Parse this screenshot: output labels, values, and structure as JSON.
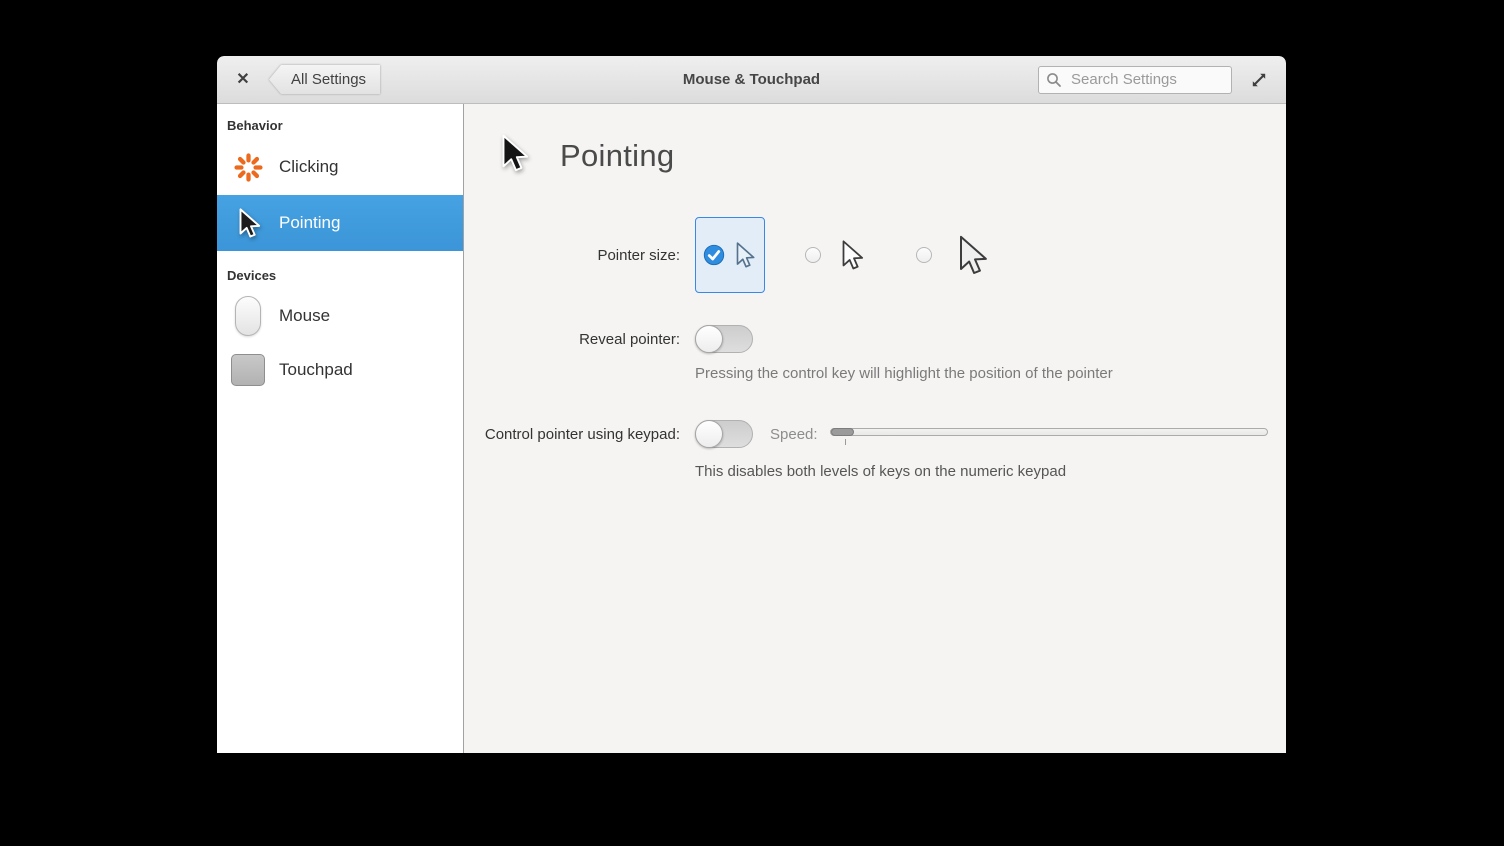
{
  "header": {
    "close_glyph": "✕",
    "back_label": "All Settings",
    "title": "Mouse & Touchpad",
    "search_placeholder": "Search Settings"
  },
  "sidebar": {
    "sections": [
      {
        "label": "Behavior",
        "items": [
          {
            "label": "Clicking",
            "icon": "clicking-burst-icon",
            "selected": false
          },
          {
            "label": "Pointing",
            "icon": "pointer-cursor-icon",
            "selected": true
          }
        ]
      },
      {
        "label": "Devices",
        "items": [
          {
            "label": "Mouse",
            "icon": "mouse-icon",
            "selected": false
          },
          {
            "label": "Touchpad",
            "icon": "touchpad-icon",
            "selected": false
          }
        ]
      }
    ]
  },
  "content": {
    "title": "Pointing",
    "pointer_size": {
      "label": "Pointer size:",
      "options": [
        "small",
        "medium",
        "large"
      ],
      "selected": "small"
    },
    "reveal_pointer": {
      "label": "Reveal pointer:",
      "state": "off",
      "help": "Pressing the control key will highlight the position of the pointer"
    },
    "keypad_pointer": {
      "label": "Control pointer using keypad:",
      "state": "off",
      "speed_label": "Speed:",
      "speed_percent": 0,
      "help": "This disables both levels of keys on the numeric keypad"
    }
  },
  "colors": {
    "selection_blue": "#3f9bdd",
    "selected_option_border": "#3689e6",
    "selected_option_bg": "#e2edf8",
    "clicking_icon_orange": "#ec6a1e",
    "content_bg": "#f5f4f2",
    "sidebar_bg": "#ffffff",
    "desktop_bg": "#000000"
  }
}
